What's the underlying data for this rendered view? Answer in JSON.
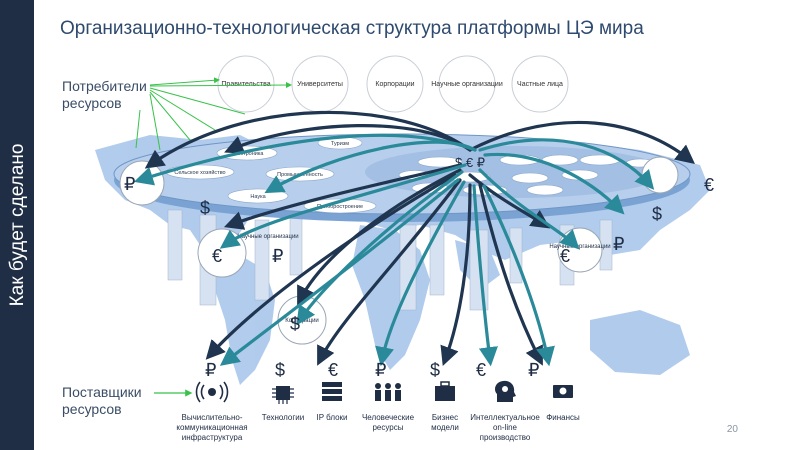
{
  "sidebar": {
    "text": "Как будет сделано"
  },
  "title": "Организационно-технологическая структура платформы ЦЭ мира",
  "labels": {
    "consumers": "Потребители ресурсов",
    "providers": "Поставщики ресурсов"
  },
  "consumers": [
    "Правительства",
    "Университеты",
    "Корпорации",
    "Научные организации",
    "Частные лица"
  ],
  "platform": {
    "currency_center": "$ € ₽",
    "left_ovals": [
      "Электроника",
      "Сельское хозяйство",
      "Промышленность",
      "Наука",
      "Приборостроение",
      "Туризм"
    ]
  },
  "side_nodes": [
    "Научные организации",
    "Корпорации",
    "Научные организации"
  ],
  "providers": [
    {
      "label": "Вычислительно-коммуникационная инфраструктура",
      "currency": "₽",
      "icon": "antenna-icon"
    },
    {
      "label": "Технологии",
      "currency": "$",
      "icon": "chip-icon"
    },
    {
      "label": "IP блоки",
      "currency": "€",
      "icon": "server-icon"
    },
    {
      "label": "Человеческие ресурсы",
      "currency": "₽",
      "icon": "people-icon"
    },
    {
      "label": "Бизнес модели",
      "currency": "$",
      "icon": "briefcase-icon"
    },
    {
      "label": "Интеллектуальное on-line производство",
      "currency": "€",
      "icon": "ai-head-icon"
    },
    {
      "label": "Финансы",
      "currency": "₽",
      "icon": "money-icon"
    }
  ],
  "floating_currencies": [
    "₽",
    "$",
    "€",
    "₽",
    "€",
    "$",
    "₽",
    "$",
    "€",
    "₽"
  ],
  "page_number": "20",
  "colors": {
    "sidebar": "#1f2d45",
    "arrow_dark": "#1f3550",
    "arrow_teal": "#2a8a99",
    "map": "#a9c6ea",
    "platform": "#8fb3dd"
  }
}
